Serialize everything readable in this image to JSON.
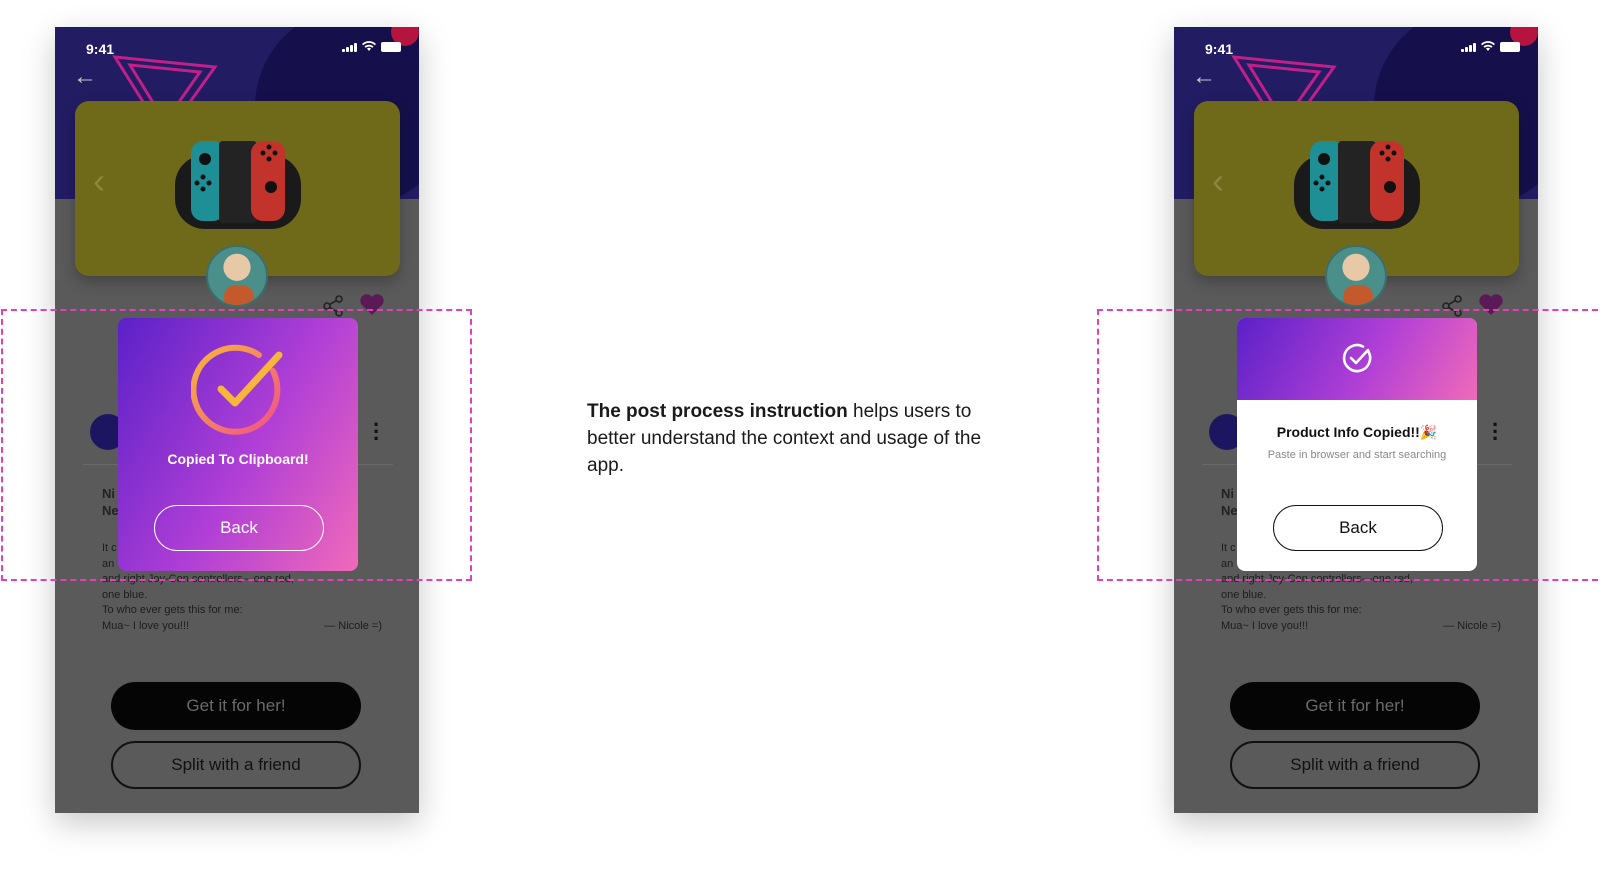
{
  "caption": {
    "bold": "The post process instruction",
    "rest": " helps users to better understand the context and usage of the app."
  },
  "phone": {
    "time": "9:41",
    "product_name_line1": "Ni",
    "product_name_line2": "Ne",
    "desc_line_a": "It c",
    "desc_line_b": "an",
    "desc_line1": "and right Joy-Con controllers—one red,",
    "desc_line2": "one blue.",
    "desc_line3": "To who ever gets this for me:",
    "desc_line4_left": "Mua~ I love you!!!",
    "desc_line4_right": "— Nicole =)",
    "cta_primary": "Get it for her!",
    "cta_secondary": "Split with a friend"
  },
  "modal_v1": {
    "title": "Copied To Clipboard!",
    "back": "Back"
  },
  "modal_v2": {
    "title": "Product Info Copied!!🎉",
    "subtitle": "Paste in browser and start searching",
    "back": "Back"
  },
  "colors": {
    "gradient_start": "#5b21c8",
    "gradient_end": "#f06ab9",
    "dashed_outline": "#e040b8"
  }
}
